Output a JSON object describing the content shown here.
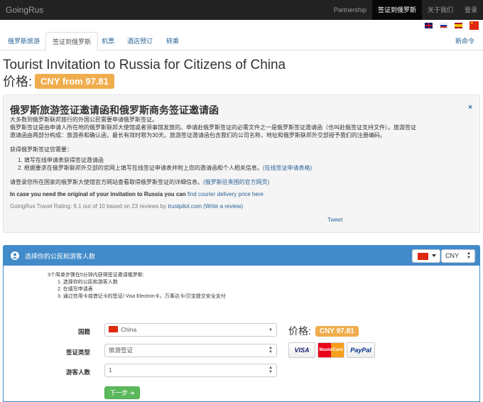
{
  "navbar": {
    "brand": "GoingRus",
    "items": [
      {
        "label": "Partnership",
        "active": false
      },
      {
        "label": "签证到俄罗斯",
        "active": true
      },
      {
        "label": "关于我们",
        "active": false
      },
      {
        "label": "登录",
        "active": false
      }
    ]
  },
  "languages": [
    "english-flag-icon",
    "russian-flag-icon",
    "spanish-flag-icon",
    "chinese-flag-icon"
  ],
  "subtabs": {
    "items": [
      {
        "label": "俄罗斯旅游",
        "active": false
      },
      {
        "label": "签证到俄罗斯",
        "active": true
      },
      {
        "label": "机票",
        "active": false
      },
      {
        "label": "酒店预订",
        "active": false
      },
      {
        "label": "转乘",
        "active": false
      }
    ],
    "right": "新命令"
  },
  "page": {
    "title": "Tourist Invitation to Russia for Citizens of China",
    "price_label": "价格:",
    "price_value": "CNY from 97.81"
  },
  "info": {
    "close": "×",
    "title": "俄罗斯旅游签证邀请函和俄罗斯商务签证邀请函",
    "line1": "大多数到俄罗斯联邦旅行的外国公民需要申请俄罗斯签证。",
    "line2": "俄罗斯签证是由申请人所在地的俄罗斯联邦大使馆或者领事馆发放的。申请赴俄罗斯签证的必需文件之一是俄罗斯签证邀请函（也叫赴俄签证支持文件）。旅游签证",
    "line3": "邀请函由两部分构成：旅游券和确认函，最长有效时限为30天。旅游签证邀请函包含我们的公司名称，地址和俄罗斯联邦外交部授予我们的注册编码。",
    "howto": "获得俄罗斯签证您需要：",
    "step1": "1. 填写在线申请表获得签证邀请函",
    "step2": "2. 根据要求在俄罗斯联邦外交部的官网上填写在线签证申请表并附上您的邀请函和个人相关信息。",
    "step2_link": "(在线签证申请表格)",
    "embassy_text": "请登录您所在国家的俄罗斯大使馆官方网站查看取得俄罗斯签证的详细信息。",
    "embassy_link": "(俄罗斯驻贵国的官方网页)",
    "original_text": "In case you need the original of your invitation to Russia you can ",
    "original_link": "find courier delivery price here",
    "rating_text": "GoingRus Travel Rating: 9.1 out of 10 based on 23 reviews by ",
    "rating_link": "trustpilot.com",
    "rating_review": "(Write a review)",
    "tweet": "Tweet"
  },
  "panel": {
    "title": "选择你的公民和游客人数",
    "currency": "CNY",
    "steps_intro": "3个简单步骤在5分钟内获得签证邀请俄罗斯:",
    "steps": [
      "1.  选择你的公民和游客人数",
      "2.  在填写申请表",
      "3.  通过信用卡或借记卡的签证/ Visa Electron卡，万事达卡/贝宝提交安全支付"
    ],
    "country_label": "国籍",
    "country_value": "China",
    "type_label": "签证类型",
    "type_value": "旅游签证",
    "count_label": "游客人数",
    "count_value": "1",
    "next": "下一步 ➔",
    "price_label": "价格:",
    "price_value": "CNY 97.81",
    "cards": [
      "VISA",
      "MasterCard",
      "PayPal"
    ]
  }
}
